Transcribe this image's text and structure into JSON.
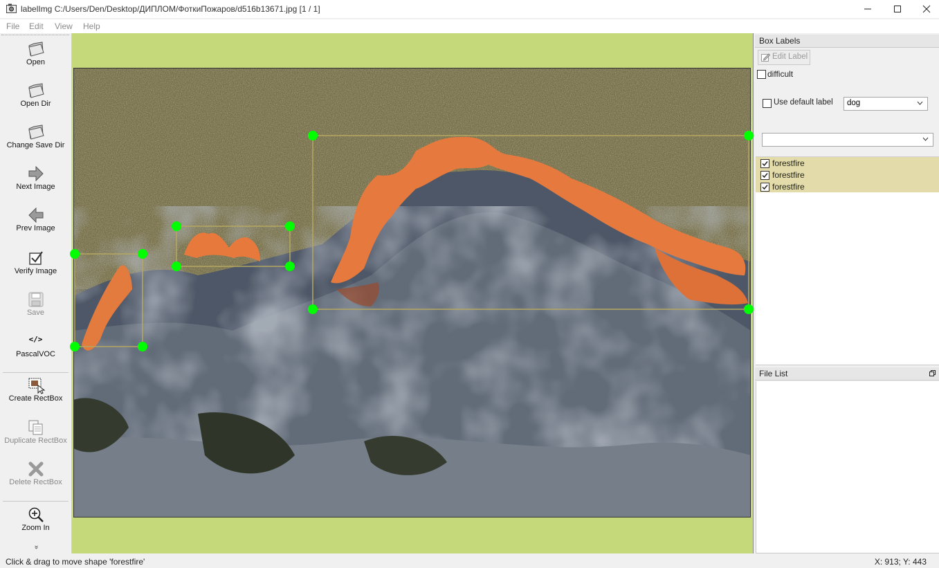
{
  "window": {
    "title": "labelImg C:/Users/Den/Desktop/ДИПЛОМ/ФоткиПожаров/d516b13671.jpg [1 / 1]",
    "controls": [
      "minimize-icon",
      "maximize-icon",
      "close-icon"
    ]
  },
  "menu": [
    "File",
    "Edit",
    "View",
    "Help"
  ],
  "toolbar": {
    "open": "Open",
    "open_dir": "Open Dir",
    "change_save_dir": "Change Save Dir",
    "next_image": "Next Image",
    "prev_image": "Prev Image",
    "verify_image": "Verify Image",
    "save": "Save",
    "format_icon_text": "</>",
    "format": "PascalVOC",
    "create_rectbox": "Create RectBox",
    "duplicate_rectbox": "Duplicate RectBox",
    "delete_rectbox": "Delete RectBox",
    "zoom_in": "Zoom In",
    "more": "»"
  },
  "box_labels": {
    "title": "Box Labels",
    "edit_label": "Edit Label",
    "difficult": "difficult",
    "difficult_checked": false,
    "use_default_label": "Use default label",
    "use_default_checked": false,
    "default_label_value": "dog",
    "filter_value": "",
    "labels": [
      {
        "name": "forestfire",
        "checked": true
      },
      {
        "name": "forestfire",
        "checked": true
      },
      {
        "name": "forestfire",
        "checked": true
      }
    ]
  },
  "file_list": {
    "title": "File List",
    "files": []
  },
  "status": {
    "message": "Click & drag to move shape 'forestfire'",
    "coords": "X: 913; Y: 443"
  },
  "colors": {
    "canvas_bg": "#c5d97a",
    "label_highlight": "#e3dcaa",
    "handle": "#00ff00",
    "box_outline": "#b5a860"
  }
}
